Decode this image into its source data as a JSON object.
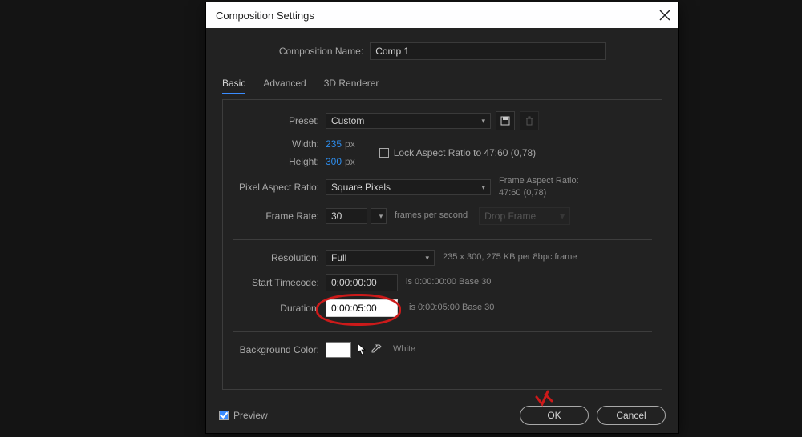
{
  "dialog": {
    "title": "Composition Settings",
    "comp_name_label": "Composition Name:",
    "comp_name_value": "Comp 1"
  },
  "tabs": {
    "basic": "Basic",
    "advanced": "Advanced",
    "renderer": "3D Renderer"
  },
  "preset": {
    "label": "Preset:",
    "value": "Custom"
  },
  "width": {
    "label": "Width:",
    "value": "235",
    "suffix": "px"
  },
  "height": {
    "label": "Height:",
    "value": "300",
    "suffix": "px"
  },
  "lock_aspect": {
    "label": "Lock Aspect Ratio to 47:60 (0,78)"
  },
  "pixel_aspect": {
    "label": "Pixel Aspect Ratio:",
    "value": "Square Pixels",
    "aside_title": "Frame Aspect Ratio:",
    "aside_value": "47:60 (0,78)"
  },
  "frame_rate": {
    "label": "Frame Rate:",
    "value": "30",
    "suffix": "frames per second",
    "drop": "Drop Frame"
  },
  "resolution": {
    "label": "Resolution:",
    "value": "Full",
    "aside": "235 x 300, 275 KB per 8bpc frame"
  },
  "start_tc": {
    "label": "Start Timecode:",
    "value": "0:00:00:00",
    "aside": "is 0:00:00:00  Base 30"
  },
  "duration": {
    "label": "Duration:",
    "value": "0:00:05:00",
    "aside": "is 0:00:05:00  Base 30"
  },
  "bg_color": {
    "label": "Background Color:",
    "name": "White",
    "value": "#ffffff"
  },
  "footer": {
    "preview": "Preview",
    "ok": "OK",
    "cancel": "Cancel"
  }
}
